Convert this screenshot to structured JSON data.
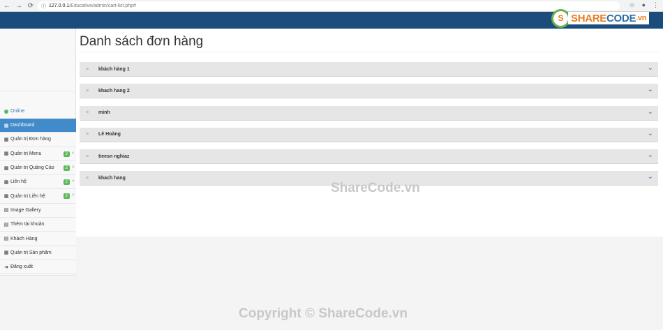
{
  "browser": {
    "back_icon": "←",
    "forward_icon": "→",
    "reload_icon": "⟳",
    "lock_icon": "ⓘ",
    "url_host": "127.0.0.1",
    "url_path": "/Educative/admin/cart-list.php#",
    "star_icon": "☆",
    "account_icon": "●",
    "menu_icon": "⋮"
  },
  "brand": {
    "logo_mark": "S",
    "logo_part_a": "SHARE",
    "logo_part_b": "CODE",
    "logo_part_c": ".vn"
  },
  "sidebar": {
    "status_text": "Online",
    "items": [
      {
        "label": "Dashboard",
        "icon": "▦",
        "active": true
      },
      {
        "label": "Quản trị Đơn hàng",
        "icon": "▦"
      },
      {
        "label": "Quản trị Menu",
        "icon": "▦",
        "badge": "2",
        "caret": "‹"
      },
      {
        "label": "Quản trị Quảng Cáo",
        "icon": "▦",
        "badge": "2",
        "caret": "‹"
      },
      {
        "label": "Liên hệ",
        "icon": "▦",
        "badge": "2",
        "caret": "‹"
      },
      {
        "label": "Quản trị Liên hệ",
        "icon": "▦",
        "badge": "2",
        "caret": "‹"
      },
      {
        "label": "Image Gallery",
        "icon": "▤"
      },
      {
        "label": "Thêm tài khoản",
        "icon": "▤"
      },
      {
        "label": "Khách Hàng",
        "icon": "▤"
      },
      {
        "label": "Quản trị Sản phẩm",
        "icon": "▦"
      },
      {
        "label": "Đăng xuất",
        "icon": "➜"
      }
    ]
  },
  "main": {
    "title": "Danh sách đơn hàng",
    "orders": [
      {
        "name": "khách hàng 1"
      },
      {
        "name": "khach hang 2"
      },
      {
        "name": "minh"
      },
      {
        "name": "Lê Hoàng"
      },
      {
        "name": "tieesn nghiaz"
      },
      {
        "name": "khach hang"
      }
    ],
    "handle_icon": "≡",
    "chevron_icon": "⌄"
  },
  "watermarks": {
    "middle": "ShareCode.vn",
    "bottom": "Copyright © ShareCode.vn"
  }
}
